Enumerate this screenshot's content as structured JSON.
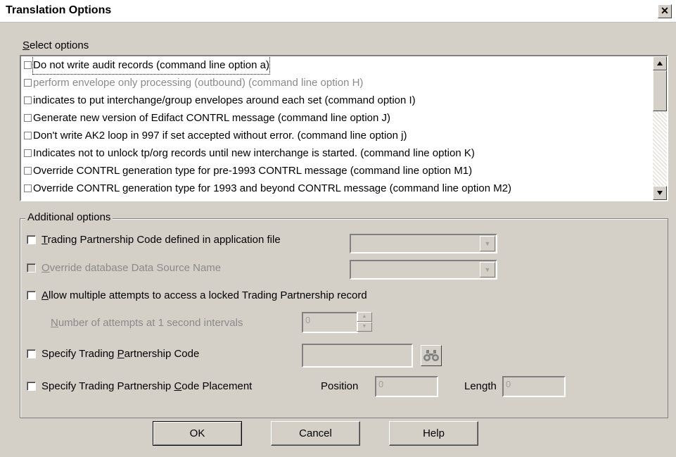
{
  "window": {
    "title": "Translation Options",
    "close_label": "✕"
  },
  "select_options": {
    "label_accel": "S",
    "label_rest": "elect options",
    "items": [
      {
        "label": "Do not write audit records (command line option a)",
        "enabled": true
      },
      {
        "label": "perform envelope only processing (outbound) (command line option H)",
        "enabled": false
      },
      {
        "label": "indicates to put interchange/group envelopes around each set (command option I)",
        "enabled": true
      },
      {
        "label": "Generate new version of Edifact CONTRL message (command line option J)",
        "enabled": true
      },
      {
        "label": "Don't write AK2 loop in 997 if set accepted without error. (command line option j)",
        "enabled": true
      },
      {
        "label": "Indicates not to unlock tp/org records until new interchange is started. (command line option K)",
        "enabled": true
      },
      {
        "label": "Override  CONTRL generation type for pre-1993 CONTRL message (command line option M1)",
        "enabled": true
      },
      {
        "label": "Override CONTRL generation type for 1993 and beyond CONTRL message (command line option M2)",
        "enabled": true
      }
    ]
  },
  "additional": {
    "group_label": "Additional options",
    "tp_code_app": {
      "accel": "T",
      "rest": "rading Partnership Code defined in application file"
    },
    "override_dsn": {
      "accel": "O",
      "rest": "verride database Data Source Name"
    },
    "multiple_attempts": {
      "accel": "A",
      "rest": "llow multiple attempts to access a locked Trading Partnership record"
    },
    "attempts_label": {
      "accel": "N",
      "rest": "umber of attempts at 1 second intervals"
    },
    "attempts_value": "0",
    "specify_tp": {
      "pre": "Specify Trading ",
      "accel": "P",
      "rest": "artnership Code"
    },
    "placement": {
      "pre": "Specify Trading Partnership ",
      "accel": "C",
      "rest": "ode Placement"
    },
    "position_label": "Position",
    "position_value": "0",
    "length_label": "Length",
    "length_value": "0"
  },
  "buttons": {
    "ok": "OK",
    "cancel": "Cancel",
    "help": "Help"
  },
  "icons": {
    "binoculars": "binoculars-icon",
    "up": "scroll-up-arrow-icon",
    "down": "scroll-down-arrow-icon"
  }
}
